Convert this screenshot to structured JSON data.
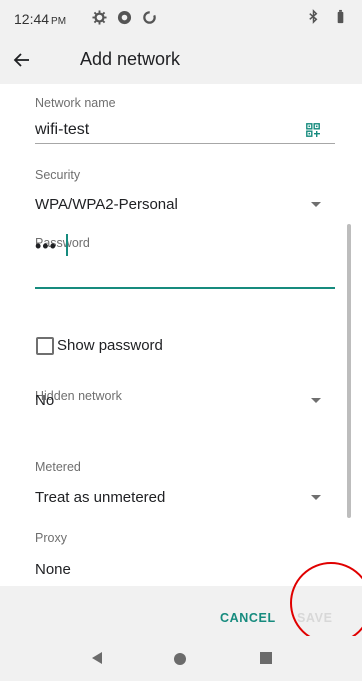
{
  "status_bar": {
    "time": "12:44",
    "ampm": "PM",
    "icons": [
      "settings-icon",
      "sync-icon",
      "data-saver-icon",
      "bluetooth-icon",
      "battery-icon"
    ]
  },
  "app_bar": {
    "title": "Add network",
    "back_icon": "arrow-left-icon"
  },
  "form": {
    "network_name": {
      "label": "Network name",
      "value": "wifi-test",
      "icon": "qr-scan-icon"
    },
    "security": {
      "label": "Security",
      "value": "WPA/WPA2-Personal"
    },
    "password": {
      "label": "Password",
      "value": "•••"
    },
    "show_password": {
      "label": "Show password",
      "checked": false
    },
    "hidden_network": {
      "label": "Hidden network",
      "value": "No"
    },
    "metered": {
      "label": "Metered",
      "value": "Treat as unmetered"
    },
    "proxy": {
      "label": "Proxy",
      "value": "None"
    }
  },
  "actions": {
    "cancel": "CANCEL",
    "save": "SAVE"
  },
  "nav": {
    "back": "back-triangle-icon",
    "home": "home-circle-icon",
    "recents": "recents-square-icon"
  },
  "colors": {
    "accent": "#168b7e",
    "highlight": "#e00000",
    "disabled": "#d8d8d8"
  }
}
